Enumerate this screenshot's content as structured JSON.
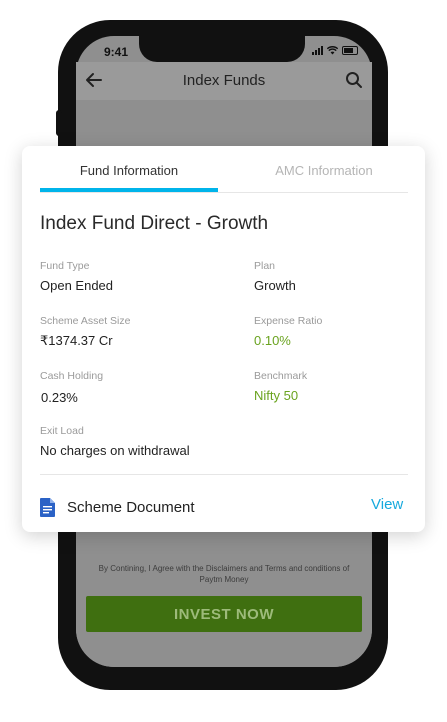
{
  "status_bar": {
    "time": "9:41"
  },
  "header": {
    "title": "Index Funds"
  },
  "tabs": [
    {
      "label": "Fund Information",
      "active": true
    },
    {
      "label": "AMC Information",
      "active": false
    }
  ],
  "fund": {
    "name": "Index Fund Direct - Growth",
    "fields": {
      "fund_type": {
        "label": "Fund Type",
        "value": "Open Ended"
      },
      "plan": {
        "label": "Plan",
        "value": "Growth"
      },
      "scheme_asset_size": {
        "label": "Scheme Asset Size",
        "value": "₹1374.37  Cr"
      },
      "expense_ratio": {
        "label": "Expense Ratio",
        "value": "0.10%"
      },
      "cash_holding": {
        "label": "Cash Holding",
        "value": "0.23%"
      },
      "benchmark": {
        "label": "Benchmark",
        "value": "Nifty 50"
      },
      "exit_load": {
        "label": "Exit Load",
        "value": "No charges on withdrawal"
      }
    }
  },
  "scheme_document": {
    "label": "Scheme Document",
    "action": "View",
    "icon": "document-icon"
  },
  "footer": {
    "disclaimer": "By Contining, I Agree with the Disclaimers and Terms and conditions of Paytm Money",
    "invest_label": "INVEST NOW"
  },
  "colors": {
    "accent": "#00b4ea",
    "link": "#16a9dd",
    "positive": "#6aa31f",
    "invest_button": "#3f6f10"
  }
}
